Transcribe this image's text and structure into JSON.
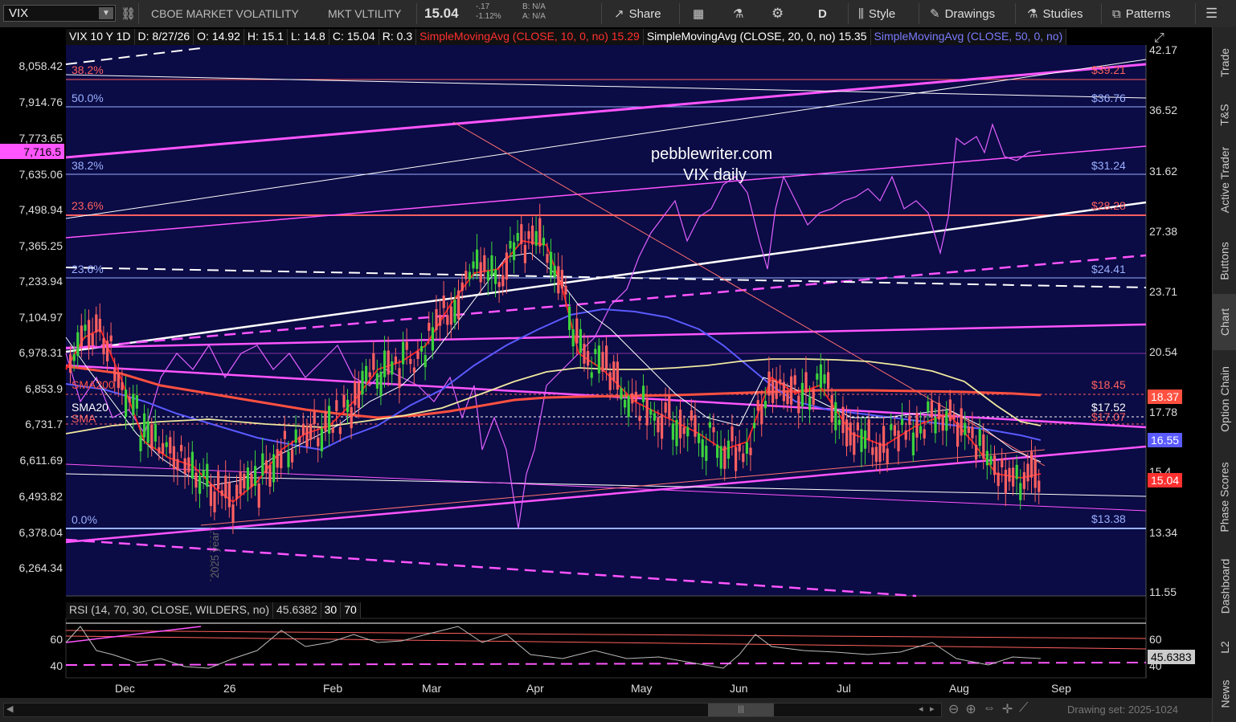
{
  "toolbar": {
    "symbol": "VIX",
    "description": "CBOE MARKET VOLATILITY",
    "exchange": "MKT VLTILITY",
    "last": "15.04",
    "change": "-.17",
    "change_pct": "-1.12%",
    "bid": "B: N/A",
    "ask": "A: N/A",
    "share": "Share",
    "aggregation": "D",
    "style": "Style",
    "drawings": "Drawings",
    "studies": "Studies",
    "patterns": "Patterns"
  },
  "study_header": {
    "title": "VIX 10 Y 1D",
    "date": "D: 8/27/26",
    "open": "O: 14.92",
    "high": "H: 15.1",
    "low": "L: 14.8",
    "close": "C: 15.04",
    "range": "R: 0.3",
    "sma10": "SimpleMovingAvg (CLOSE, 10, 0, no)",
    "sma10_val": "15.29",
    "sma20": "SimpleMovingAvg (CLOSE, 20, 0, no)",
    "sma20_val": "15.35",
    "sma50": "SimpleMovingAvg (CLOSE, 50, 0, no)"
  },
  "rsi_header": {
    "label": "RSI (14, 70, 30, CLOSE, WILDERS, no)",
    "value": "45.6382",
    "low": "30",
    "high": "70"
  },
  "left_axis": [
    "8,058.42",
    "7,914.76",
    "7,773.65",
    "7,635.06",
    "7,498.94",
    "7,365.25",
    "7,233.94",
    "7,104.97",
    "6,978.31",
    "6,853.9",
    "6,731.7",
    "6,611.69",
    "6,493.82",
    "6,378.04",
    "6,264.34"
  ],
  "left_axis_marker": "7,716.5",
  "right_axis": [
    "42.17",
    "36.52",
    "31.62",
    "27.38",
    "23.71",
    "20.54",
    "17.78",
    "15.4",
    "13.34",
    "11.55"
  ],
  "rsi_axis": {
    "left": [
      "60",
      "40"
    ],
    "right": [
      "60",
      "40"
    ],
    "value_tag": "45.6383"
  },
  "right_tags": {
    "sma200": "18.37",
    "sma50": "16.55",
    "last": "15.04"
  },
  "fib_left": [
    "38.2%",
    "50.0%",
    "38.2%",
    "23.6%",
    "23.6%",
    "0.0%"
  ],
  "fib_right": [
    "$39.21",
    "$36.76",
    "$31.24",
    "$28.28",
    "$24.41",
    "$18.45",
    "$17.52",
    "$17.07",
    "$13.38"
  ],
  "sma_labels": [
    "SMA200",
    "SMA20",
    "SMA"
  ],
  "annotation": {
    "line1": "pebblewriter.com",
    "line2": "VIX daily"
  },
  "year_marker": "2025 year",
  "x_axis": [
    "Dec",
    "26",
    "Feb",
    "Mar",
    "Apr",
    "May",
    "Jun",
    "Jul",
    "Aug",
    "Sep"
  ],
  "drawing_set": "Drawing set: 2025-1024",
  "sidebar": [
    "Trade",
    "T&S",
    "Active Trader",
    "Buttons",
    "Chart",
    "Option Chain",
    "Phase Scores",
    "Dashboard",
    "L2",
    "News"
  ],
  "colors": {
    "bg": "#000000",
    "plot_bg": "#0b0b45",
    "magenta": "#ff55ff",
    "fib_red": "#ff6060",
    "sma_red": "#ff3030",
    "sma_blue": "#5a5aff",
    "sma_yellow": "#f0e8a0",
    "candle_up": "#3cd23c",
    "candle_down": "#ff6060"
  }
}
